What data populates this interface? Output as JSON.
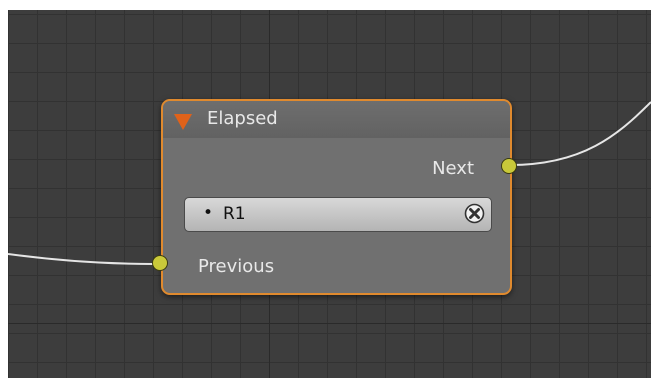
{
  "node": {
    "title": "Elapsed",
    "output_label": "Next",
    "input_label": "Previous",
    "field": {
      "bullet": "•",
      "value": "R1"
    },
    "icons": {
      "collapse": "triangle-down-icon",
      "clear": "x-circle-icon"
    }
  },
  "colors": {
    "canvas_background": "#3d3d3d",
    "node_body": "#707070",
    "node_border": "#e08a2e",
    "collapse_arrow": "#e0621a",
    "socket": "#c9c93a",
    "link": "#e6e6e6"
  }
}
